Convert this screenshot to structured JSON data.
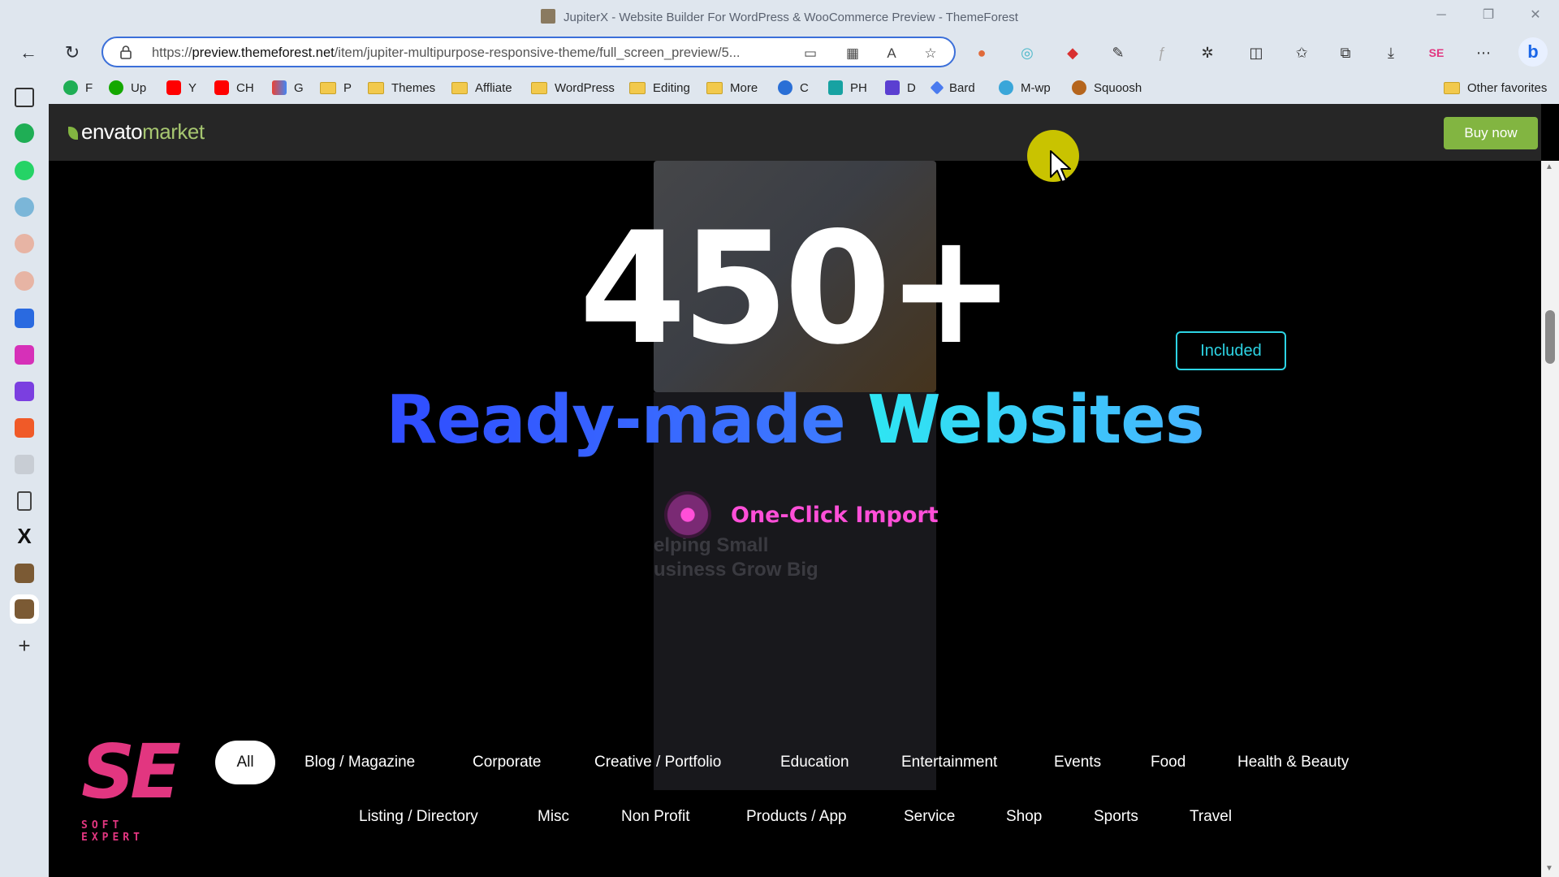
{
  "browser": {
    "title": "JupiterX - Website Builder For WordPress & WooCommerce Preview - ThemeForest",
    "url_prefix": "https://",
    "url_domain": "preview.themeforest.net",
    "url_path": "/item/jupiter-multipurpose-responsive-theme/full_screen_preview/5...",
    "bookmarks": [
      "F",
      "Up",
      "Y",
      "CH",
      "G",
      "P",
      "Themes",
      "Affliate",
      "WordPress",
      "Editing",
      "More",
      "C",
      "PH",
      "D",
      "Bard",
      "M-wp",
      "Squoosh"
    ],
    "other_favorites": "Other favorites"
  },
  "envato": {
    "logo_envato": "envato",
    "logo_market": "market",
    "buy_now": "Buy now"
  },
  "hero": {
    "count": "450+",
    "headline_part1": "Ready-made",
    "headline_part2": "Websites",
    "badge": "Included",
    "feature": "One-Click Import",
    "bg_preview_line1": "elping Small",
    "bg_preview_line2": "usiness Grow Big"
  },
  "brand": {
    "logo_letters": "SE",
    "logo_sub": "SOFT EXPERT"
  },
  "filters": {
    "row1": [
      "All",
      "Blog / Magazine",
      "Corporate",
      "Creative / Portfolio",
      "Education",
      "Entertainment",
      "Events",
      "Food",
      "Health & Beauty"
    ],
    "row2": [
      "Listing / Directory",
      "Misc",
      "Non Profit",
      "Products / App",
      "Service",
      "Shop",
      "Sports",
      "Travel"
    ]
  },
  "colors": {
    "accent_green": "#82b541",
    "cyan": "#2dd4e4",
    "blue": "#2f4cff",
    "pink": "#ff4fd8"
  }
}
